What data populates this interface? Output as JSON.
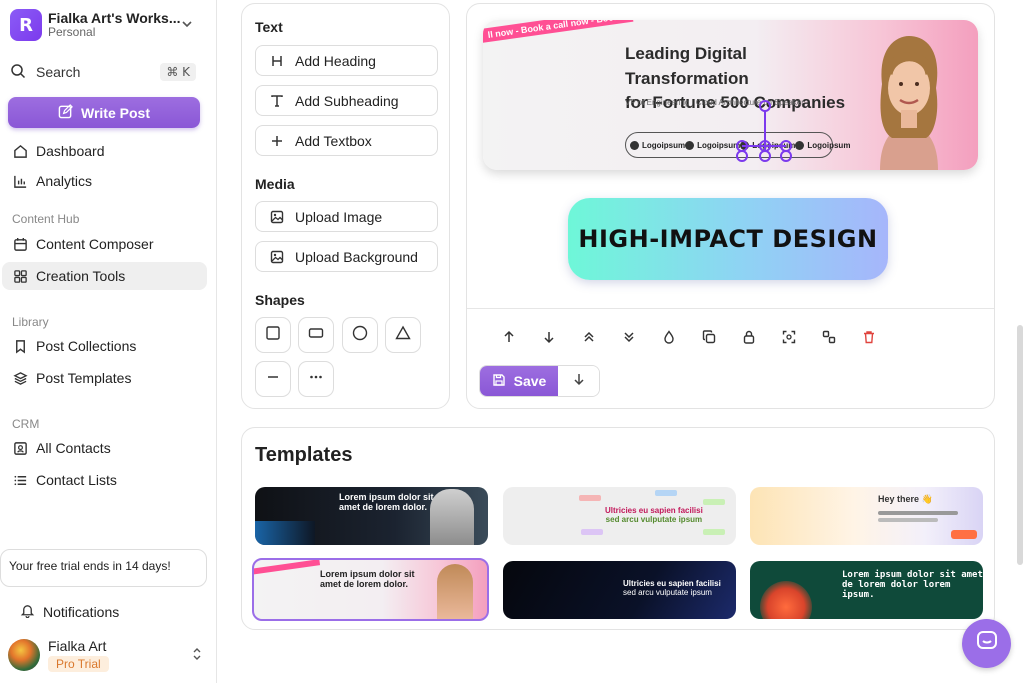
{
  "workspace": {
    "name": "Fialka Art's Works...",
    "plan": "Personal"
  },
  "search": {
    "label": "Search",
    "shortcut": "⌘ K"
  },
  "write_button": "Write Post",
  "nav": {
    "dashboard": "Dashboard",
    "analytics": "Analytics",
    "content_hub_title": "Content Hub",
    "content_composer": "Content Composer",
    "creation_tools": "Creation Tools",
    "library_title": "Library",
    "post_collections": "Post Collections",
    "post_templates": "Post Templates",
    "crm_title": "CRM",
    "all_contacts": "All Contacts",
    "contact_lists": "Contact Lists"
  },
  "trial_notice": "Your free trial ends in 14 days!",
  "notifications": "Notifications",
  "user": {
    "name": "Fialka Art",
    "badge": "Pro Trial"
  },
  "tools": {
    "text_title": "Text",
    "add_heading": "Add Heading",
    "add_subheading": "Add Subheading",
    "add_textbox": "Add Textbox",
    "media_title": "Media",
    "upload_image": "Upload Image",
    "upload_background": "Upload Background",
    "shapes_title": "Shapes"
  },
  "banner": {
    "ribbon": "ll now - Book a call now - Book a call now",
    "headline_line1": "Leading Digital Transformation",
    "headline_line2": "for Fortune 500 Companies",
    "subtitle": "VP of Engineering | Cloud Architecture    ch Speaker",
    "logo_text": "Logoipsum"
  },
  "impact_text": "HIGH-IMPACT DESIGN",
  "save_button": "Save",
  "templates": {
    "title": "Templates",
    "t1": {
      "line1": "Lorem ipsum dolor sit",
      "line2": "amet de lorem dolor."
    },
    "t2": {
      "line1": "Ultricies eu sapien facilisi",
      "line2": "sed arcu vulputate ipsum"
    },
    "t3": {
      "line1": "Hey there 👋"
    },
    "t4": {
      "line1": "Lorem ipsum dolor sit",
      "line2": "amet de lorem dolor."
    },
    "t5": {
      "line1": "Ultricies eu sapien facilisi",
      "line2": "sed arcu vulputate ipsum"
    },
    "t6": {
      "line1": "Lorem ipsum dolor sit amet",
      "line2": "de lorem dolor lorem ipsum."
    }
  }
}
